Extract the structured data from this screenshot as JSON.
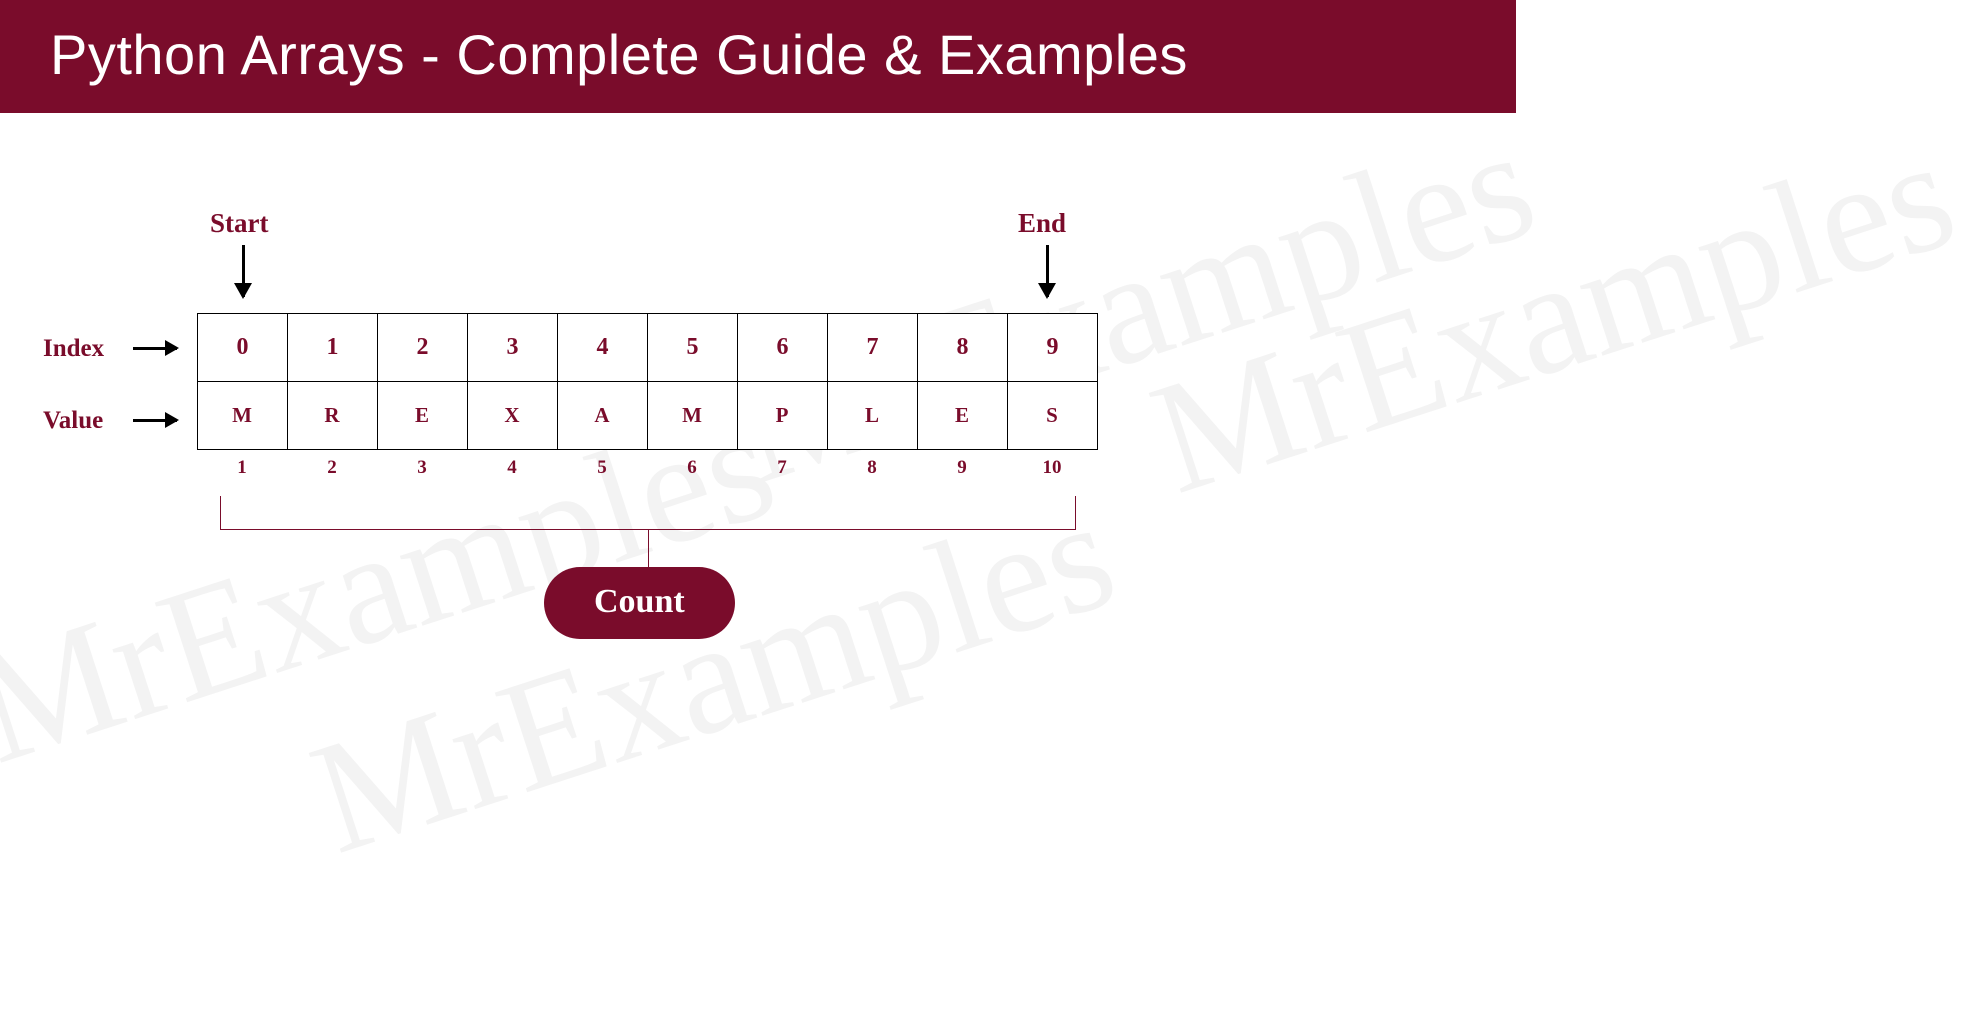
{
  "header": {
    "title": "Python Arrays - Complete Guide & Examples"
  },
  "labels": {
    "start": "Start",
    "end": "End",
    "index": "Index",
    "value": "Value",
    "count": "Count"
  },
  "array": {
    "indices": [
      "0",
      "1",
      "2",
      "3",
      "4",
      "5",
      "6",
      "7",
      "8",
      "9"
    ],
    "values": [
      "M",
      "R",
      "E",
      "X",
      "A",
      "M",
      "P",
      "L",
      "E",
      "S"
    ],
    "counts": [
      "1",
      "2",
      "3",
      "4",
      "5",
      "6",
      "7",
      "8",
      "9",
      "10"
    ]
  },
  "watermark": "MrExamples",
  "colors": {
    "brand": "#7a0c2b"
  }
}
